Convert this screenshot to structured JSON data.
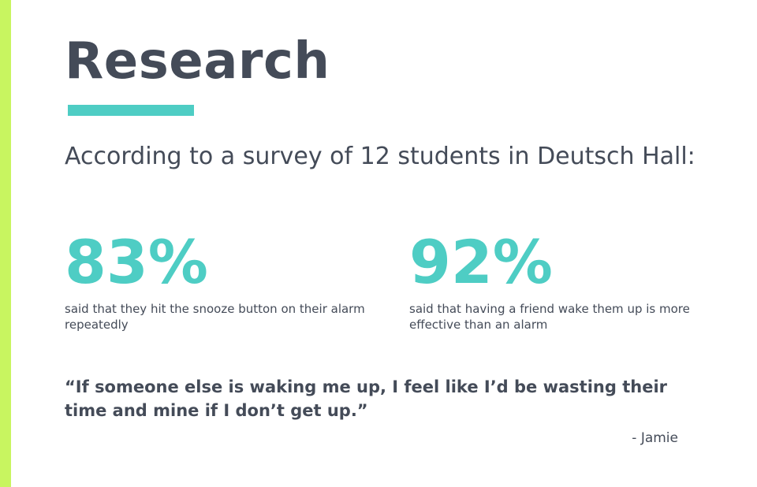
{
  "slide": {
    "title": "Research",
    "intro": "According to a survey of 12 students in Deutsch Hall:",
    "stats": [
      {
        "value": "83%",
        "description": "said that they hit the snooze button on their alarm repeatedly"
      },
      {
        "value": "92%",
        "description": "said that having a friend wake them up is more effective than an alarm"
      }
    ],
    "quote": "“If someone else is waking me up, I feel like I’d be wasting their time and mine if I don’t get up.”",
    "attribution": "- Jamie"
  },
  "colors": {
    "accent_bar": "#c8f560",
    "teal": "#4ecdc4",
    "text": "#444b58"
  }
}
